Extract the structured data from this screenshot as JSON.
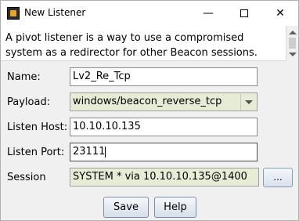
{
  "window": {
    "title": "New Listener",
    "icon": "cobalt-strike-app-icon",
    "controls": {
      "minimize": "—",
      "close": "✕"
    }
  },
  "description": "A pivot listener is a way to use a compromised system as a redirector for other Beacon sessions.",
  "form": {
    "name": {
      "label": "Name:",
      "value": "Lv2_Re_Tcp"
    },
    "payload": {
      "label": "Payload:",
      "value": "windows/beacon_reverse_tcp"
    },
    "listen_host": {
      "label": "Listen Host:",
      "value": "10.10.10.135"
    },
    "listen_port": {
      "label": "Listen Port:",
      "value": "23111"
    },
    "session": {
      "label": "Session",
      "value": "SYSTEM * via  10.10.10.135@1400",
      "browse_label": "..."
    }
  },
  "buttons": {
    "save": "Save",
    "help": "Help"
  },
  "colors": {
    "readonly_field_bg": "#e6ecd6",
    "window_bg": "#f0f0f0"
  }
}
